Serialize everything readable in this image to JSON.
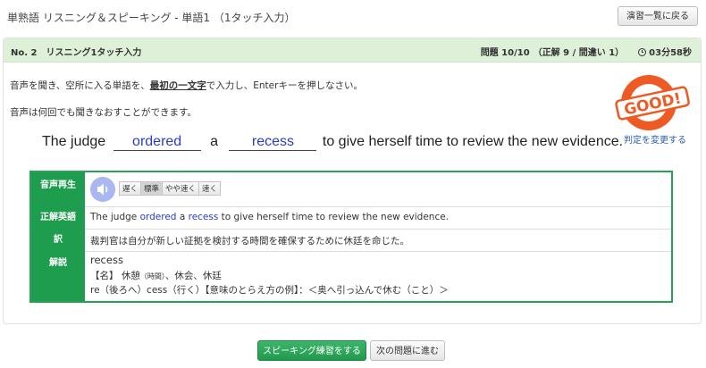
{
  "app": {
    "title": "単熟語 リスニング＆スピーキング - 単語1 （1タッチ入力）",
    "back_button": "演習一覧に戻る"
  },
  "panel": {
    "header_left": "No. 2　リスニング1タッチ入力",
    "progress": "問題 10/10",
    "score": "（正解 9 / 間違い 1）",
    "timer": "03分58秒"
  },
  "instructions": {
    "line1_pre": "音声を聞き、空所に入る単語を、",
    "line1_emph": "最初の一文字",
    "line1_post": "で入力し、Enterキーを押しなさい。",
    "line2": "音声は何回でも聞きなおすことができます。"
  },
  "result": {
    "badge": "GOOD!",
    "change_link": "判定を変更する"
  },
  "sentence": {
    "part1": "The judge",
    "blank1": "ordered",
    "part2": "a",
    "blank2": "recess",
    "part3": "to give herself time to review the new evidence."
  },
  "detail": {
    "audio_label": "音声再生",
    "speeds": [
      "遅く",
      "標準",
      "やや速く",
      "速く"
    ],
    "answer_label": "正解英語",
    "answer_pre": "The judge ",
    "answer_w1": "ordered",
    "answer_mid": " a ",
    "answer_w2": "recess",
    "answer_post": " to give herself time to review the new evidence.",
    "translation_label": "訳",
    "translation": "裁判官は自分が新しい証拠を検討する時間を確保するために休廷を命じた。",
    "explanation_label": "解説",
    "exp_word": "recess",
    "exp_line2_pre": "【名】 休憩",
    "exp_line2_small": "（時間）",
    "exp_line2_post": "、休会、休廷",
    "exp_line3": "re（後ろへ）cess（行く）【意味のとらえ方の例】：＜奥へ引っ込んで休む（こと）＞"
  },
  "footer": {
    "speaking_button": "スピーキング練習をする",
    "next_button": "次の問題に進む"
  },
  "colors": {
    "accent_green": "#1f9d4f",
    "header_green": "#dff0d8",
    "good_orange": "#ee5a24",
    "answer_blue": "#2a3bcc"
  }
}
